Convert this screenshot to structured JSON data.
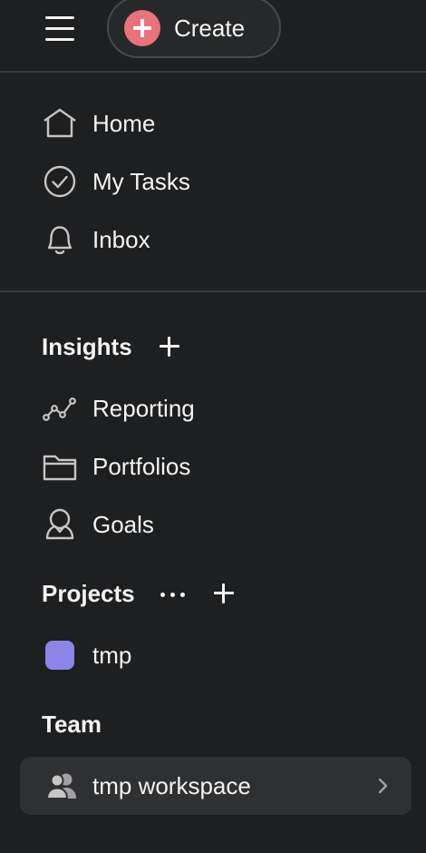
{
  "topbar": {
    "menu_icon": "hamburger-menu-icon",
    "create_label": "Create",
    "create_icon": "plus-circle-icon",
    "create_icon_color": "#e8737b"
  },
  "main_nav": [
    {
      "label": "Home",
      "icon": "home-icon"
    },
    {
      "label": "My Tasks",
      "icon": "check-circle-icon"
    },
    {
      "label": "Inbox",
      "icon": "bell-icon"
    }
  ],
  "insights": {
    "heading": "Insights",
    "add_icon": "plus-icon",
    "items": [
      {
        "label": "Reporting",
        "icon": "reporting-line-icon"
      },
      {
        "label": "Portfolios",
        "icon": "folder-icon"
      },
      {
        "label": "Goals",
        "icon": "goal-person-icon"
      }
    ]
  },
  "projects": {
    "heading": "Projects",
    "more_icon": "more-dots-icon",
    "add_icon": "plus-icon",
    "items": [
      {
        "label": "tmp",
        "color": "#8d84e8"
      }
    ]
  },
  "team": {
    "heading": "Team",
    "items": [
      {
        "label": "tmp workspace",
        "icon": "team-people-icon",
        "chevron": "chevron-right-icon"
      }
    ]
  },
  "colors": {
    "background": "#1e1f21",
    "divider": "#3a3b3d",
    "text": "#f5f4f3",
    "team_row_bg": "#2f3032"
  }
}
